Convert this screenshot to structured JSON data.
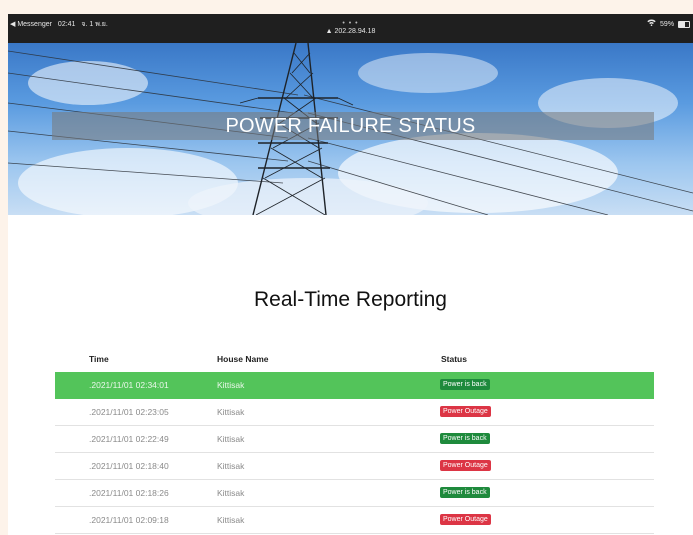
{
  "statusbar": {
    "app_back": "◀ Messenger",
    "time": "02:41",
    "date": "จ. 1 พ.ย.",
    "dots": "• • •",
    "url": "▲ 202.28.94.18",
    "wifi_icon": "wifi-icon",
    "battery_percent": "59%"
  },
  "hero": {
    "title": "POWER FAILURE STATUS"
  },
  "main": {
    "heading": "Real-Time Reporting",
    "table": {
      "headers": [
        "Time",
        "House Name",
        "Status"
      ],
      "rows": [
        {
          "time": ".2021/11/01 02:34:01",
          "house": "Kittisak",
          "status": "Power is back"
        },
        {
          "time": ".2021/11/01 02:23:05",
          "house": "Kittisak",
          "status": "Power Outage"
        },
        {
          "time": ".2021/11/01 02:22:49",
          "house": "Kittisak",
          "status": "Power is back"
        },
        {
          "time": ".2021/11/01 02:18:40",
          "house": "Kittisak",
          "status": "Power Outage"
        },
        {
          "time": ".2021/11/01 02:18:26",
          "house": "Kittisak",
          "status": "Power is back"
        },
        {
          "time": ".2021/11/01 02:09:18",
          "house": "Kittisak",
          "status": "Power Outage"
        }
      ]
    }
  },
  "colors": {
    "power_back": "#1e8a3c",
    "power_outage": "#dc3545",
    "active_row": "#53c45a"
  }
}
